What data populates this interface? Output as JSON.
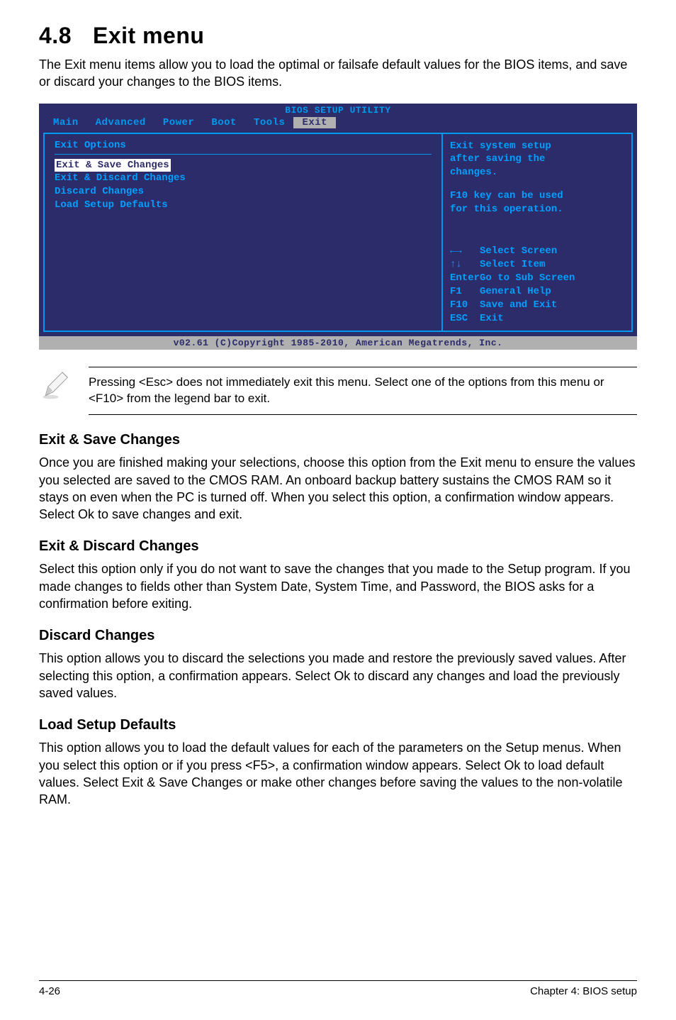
{
  "header": {
    "section_number": "4.8",
    "section_title": "Exit menu"
  },
  "intro": "The Exit menu items allow you to load the optimal or failsafe default values for the BIOS items, and save or discard your changes to the BIOS items.",
  "bios": {
    "title": "BIOS SETUP UTILITY",
    "tabs": [
      "Main",
      "Advanced",
      "Power",
      "Boot",
      "Tools",
      "Exit"
    ],
    "active_tab": "Exit",
    "left_heading": "Exit Options",
    "left_items": [
      "Exit & Save Changes",
      "Exit & Discard Changes",
      "Discard Changes",
      "",
      "Load Setup Defaults"
    ],
    "selected_item_index": 0,
    "right_top": [
      "Exit system setup",
      "after saving the",
      "changes.",
      "",
      "F10 key can be used",
      "for this operation."
    ],
    "right_bottom": [
      {
        "key": "←→",
        "label": "Select Screen"
      },
      {
        "key": "↑↓",
        "label": "Select Item"
      },
      {
        "key": "Enter",
        "label": "Go to Sub Screen"
      },
      {
        "key": "F1",
        "label": "General Help"
      },
      {
        "key": "F10",
        "label": "Save and Exit"
      },
      {
        "key": "ESC",
        "label": "Exit"
      }
    ],
    "footer": "v02.61 (C)Copyright 1985-2010, American Megatrends, Inc."
  },
  "note": "Pressing <Esc> does not immediately exit this menu. Select one of the options from this menu or <F10> from the legend bar to exit.",
  "sections": [
    {
      "heading": "Exit & Save Changes",
      "body": "Once you are finished making your selections, choose this option from the Exit menu to ensure the values you selected are saved to the CMOS RAM. An onboard backup battery sustains the CMOS RAM so it stays on even when the PC is turned off. When you select this option, a confirmation window appears. Select Ok to save changes and exit."
    },
    {
      "heading": "Exit & Discard Changes",
      "body": "Select this option only if you do not want to save the changes that you  made to the Setup program. If you made changes to fields other than System Date, System Time, and Password, the BIOS asks for a confirmation before exiting."
    },
    {
      "heading": "Discard Changes",
      "body": "This option allows you to discard the selections you made and restore the previously saved values. After selecting this option, a confirmation appears. Select Ok to discard any changes and load the previously saved values."
    },
    {
      "heading": "Load Setup Defaults",
      "body": "This option allows you to load the default values for each of the parameters on the Setup menus. When you select this option or if you press <F5>, a confirmation window appears. Select Ok to load default values. Select Exit & Save Changes or make other changes before saving the values to the non-volatile RAM."
    }
  ],
  "footer": {
    "left": "4-26",
    "right": "Chapter 4: BIOS setup"
  }
}
